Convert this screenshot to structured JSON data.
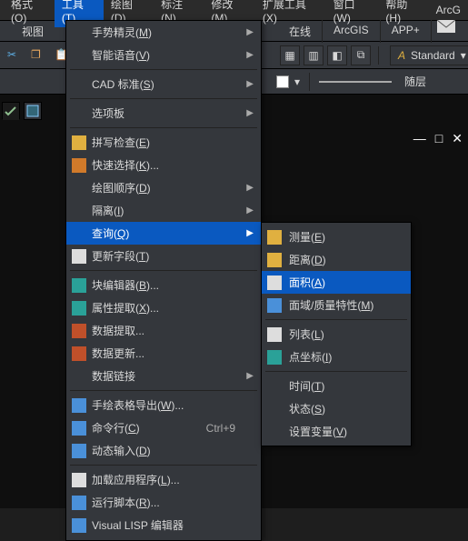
{
  "menubar": {
    "items": [
      {
        "label": "格式(O)"
      },
      {
        "label": "工具(T)",
        "active": true
      },
      {
        "label": "绘图(D)"
      },
      {
        "label": "标注(N)"
      },
      {
        "label": "修改(M)"
      },
      {
        "label": "扩展工具(X)"
      },
      {
        "label": "窗口(W)"
      },
      {
        "label": "帮助(H)"
      },
      {
        "label": "ArcG"
      }
    ]
  },
  "view_label": "视图",
  "right_tabs": [
    "在线",
    "ArcGIS",
    "APP+"
  ],
  "style_box": {
    "text": "Standard"
  },
  "layer_label": "随层",
  "dropdown": {
    "groups": [
      [
        {
          "label": "手势精灵(M)",
          "arrow": true
        },
        {
          "label": "智能语音(V)",
          "arrow": true
        }
      ],
      [
        {
          "label": "CAD 标准(S)",
          "arrow": true
        }
      ],
      [
        {
          "label": "选项板",
          "arrow": true
        }
      ],
      [
        {
          "label": "拼写检查(E)",
          "icon": "i-yellow"
        },
        {
          "label": "快速选择(K)...",
          "icon": "i-orange"
        },
        {
          "label": "绘图顺序(D)",
          "arrow": true
        },
        {
          "label": "隔离(I)",
          "arrow": true
        },
        {
          "label": "查询(Q)",
          "arrow": true,
          "highlight": true
        },
        {
          "label": "更新字段(T)",
          "icon": "i-white"
        }
      ],
      [
        {
          "label": "块编辑器(B)...",
          "icon": "i-teal"
        },
        {
          "label": "属性提取(X)...",
          "icon": "i-teal"
        },
        {
          "label": "数据提取...",
          "icon": "i-red"
        },
        {
          "label": "数据更新...",
          "icon": "i-red"
        },
        {
          "label": "数据链接",
          "arrow": true
        }
      ],
      [
        {
          "label": "手绘表格导出(W)...",
          "icon": "i-blue"
        },
        {
          "label": "命令行(C)",
          "icon": "i-blue",
          "shortcut": "Ctrl+9"
        },
        {
          "label": "动态输入(D)",
          "icon": "i-blue"
        }
      ],
      [
        {
          "label": "加载应用程序(L)...",
          "icon": "i-white"
        },
        {
          "label": "运行脚本(R)...",
          "icon": "i-blue"
        },
        {
          "label": "Visual LISP 编辑器",
          "icon": "i-blue"
        }
      ]
    ]
  },
  "submenu": {
    "groups": [
      [
        {
          "label": "测量(E)",
          "icon": "i-yellow"
        },
        {
          "label": "距离(D)",
          "icon": "i-yellow"
        },
        {
          "label": "面积(A)",
          "icon": "i-white",
          "highlight": true
        },
        {
          "label": "面域/质量特性(M)",
          "icon": "i-blue"
        }
      ],
      [
        {
          "label": "列表(L)",
          "icon": "i-white"
        },
        {
          "label": "点坐标(I)",
          "icon": "i-teal"
        }
      ],
      [
        {
          "label": "时间(T)"
        },
        {
          "label": "状态(S)"
        },
        {
          "label": "设置变量(V)"
        }
      ]
    ]
  }
}
